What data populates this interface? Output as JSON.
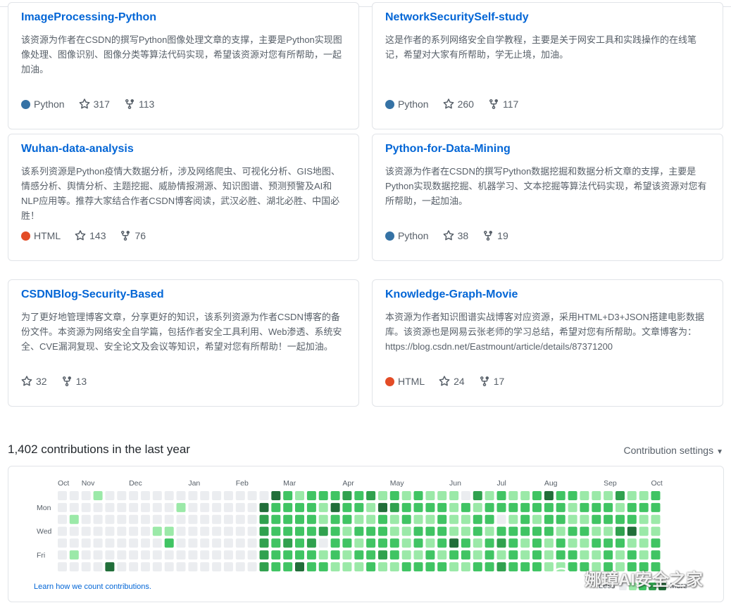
{
  "repos": [
    {
      "name": "ImageProcessing-Python",
      "description": "该资源为作者在CSDN的撰写Python图像处理文章的支撑，主要是Python实现图像处理、图像识别、图像分类等算法代码实现，希望该资源对您有所帮助，一起加油。",
      "language": "Python",
      "language_color": "#3572A5",
      "stars": "317",
      "forks": "113"
    },
    {
      "name": "NetworkSecuritySelf-study",
      "description": "这是作者的系列网络安全自学教程，主要是关于网安工具和实践操作的在线笔记，希望对大家有所帮助，学无止境，加油。",
      "language": "Python",
      "language_color": "#3572A5",
      "stars": "260",
      "forks": "117"
    },
    {
      "name": "Wuhan-data-analysis",
      "description": "该系列资源是Python疫情大数据分析，涉及网络爬虫、可视化分析、GIS地图、情感分析、舆情分析、主题挖掘、威胁情报溯源、知识图谱、预测预警及AI和NLP应用等。推荐大家结合作者CSDN博客阅读，武汉必胜、湖北必胜、中国必胜！",
      "language": "HTML",
      "language_color": "#e34c26",
      "stars": "143",
      "forks": "76"
    },
    {
      "name": "Python-for-Data-Mining",
      "description": "该资源为作者在CSDN的撰写Python数据挖掘和数据分析文章的支撑，主要是Python实现数据挖掘、机器学习、文本挖掘等算法代码实现，希望该资源对您有所帮助，一起加油。",
      "language": "Python",
      "language_color": "#3572A5",
      "stars": "38",
      "forks": "19"
    },
    {
      "name": "CSDNBlog-Security-Based",
      "description": "为了更好地管理博客文章，分享更好的知识，该系列资源为作者CSDN博客的备份文件。本资源为网络安全自学篇，包括作者安全工具利用、Web渗透、系统安全、CVE漏洞复现、安全论文及会议等知识，希望对您有所帮助！一起加油。",
      "language": "",
      "language_color": "",
      "stars": "32",
      "forks": "13"
    },
    {
      "name": "Knowledge-Graph-Movie",
      "description": "本资源为作者知识图谱实战博客对应资源，采用HTML+D3+JSON搭建电影数据库。该资源也是网易云张老师的学习总结，希望对您有所帮助。文章博客为：https://blog.csdn.net/Eastmount/article/details/87371200",
      "language": "HTML",
      "language_color": "#e34c26",
      "stars": "24",
      "forks": "17"
    }
  ],
  "contributions": {
    "title": "1,402 contributions in the last year",
    "settings_label": "Contribution settings",
    "months": [
      "Oct",
      "Nov",
      "Dec",
      "Jan",
      "Feb",
      "Mar",
      "Apr",
      "May",
      "Jun",
      "Jul",
      "Aug",
      "Sep",
      "Oct"
    ],
    "month_week_index": [
      0,
      2,
      6,
      11,
      15,
      19,
      24,
      28,
      33,
      37,
      41,
      46,
      50
    ],
    "day_labels": [
      "",
      "Mon",
      "",
      "Wed",
      "",
      "Fri",
      ""
    ],
    "learn_link": "Learn how we count contributions.",
    "legend_less": "Less",
    "legend_more": "More",
    "colors": [
      "#ebedf0",
      "#9be9a8",
      "#40c463",
      "#30a14e",
      "#216e39"
    ],
    "weeks": [
      [
        0,
        0,
        0,
        0,
        0,
        0,
        0
      ],
      [
        0,
        0,
        1,
        0,
        0,
        1,
        0
      ],
      [
        0,
        0,
        0,
        0,
        0,
        0,
        0
      ],
      [
        1,
        0,
        0,
        0,
        0,
        0,
        0
      ],
      [
        0,
        0,
        0,
        0,
        0,
        0,
        4
      ],
      [
        0,
        0,
        0,
        0,
        0,
        0,
        0
      ],
      [
        0,
        0,
        0,
        0,
        0,
        0,
        0
      ],
      [
        0,
        0,
        0,
        0,
        0,
        0,
        0
      ],
      [
        0,
        0,
        0,
        1,
        0,
        0,
        0
      ],
      [
        0,
        0,
        0,
        1,
        2,
        0,
        0
      ],
      [
        0,
        1,
        0,
        0,
        0,
        0,
        0
      ],
      [
        0,
        0,
        0,
        0,
        0,
        0,
        0
      ],
      [
        0,
        0,
        0,
        0,
        0,
        0,
        0
      ],
      [
        0,
        0,
        0,
        0,
        0,
        0,
        0
      ],
      [
        0,
        0,
        0,
        0,
        0,
        0,
        0
      ],
      [
        0,
        0,
        0,
        0,
        0,
        0,
        0
      ],
      [
        0,
        0,
        0,
        0,
        0,
        0,
        0
      ],
      [
        0,
        4,
        3,
        3,
        3,
        3,
        3
      ],
      [
        4,
        2,
        2,
        2,
        2,
        2,
        2
      ],
      [
        2,
        2,
        2,
        2,
        3,
        2,
        2
      ],
      [
        1,
        2,
        2,
        2,
        2,
        2,
        4
      ],
      [
        2,
        2,
        2,
        2,
        3,
        2,
        2
      ],
      [
        2,
        1,
        1,
        3,
        0,
        1,
        2
      ],
      [
        2,
        4,
        2,
        2,
        2,
        2,
        1
      ],
      [
        3,
        2,
        2,
        1,
        2,
        1,
        1
      ],
      [
        2,
        2,
        1,
        2,
        1,
        2,
        1
      ],
      [
        3,
        1,
        1,
        2,
        2,
        2,
        2
      ],
      [
        1,
        4,
        2,
        2,
        2,
        3,
        1
      ],
      [
        2,
        3,
        1,
        1,
        2,
        2,
        1
      ],
      [
        1,
        2,
        2,
        1,
        1,
        1,
        2
      ],
      [
        2,
        2,
        1,
        2,
        2,
        1,
        2
      ],
      [
        1,
        2,
        1,
        2,
        1,
        2,
        2
      ],
      [
        1,
        2,
        2,
        2,
        2,
        1,
        2
      ],
      [
        1,
        1,
        1,
        1,
        4,
        2,
        1
      ],
      [
        0,
        2,
        1,
        1,
        2,
        2,
        1
      ],
      [
        3,
        1,
        2,
        2,
        1,
        1,
        2
      ],
      [
        1,
        2,
        2,
        1,
        2,
        2,
        2
      ],
      [
        2,
        2,
        0,
        2,
        3,
        1,
        3
      ],
      [
        1,
        2,
        1,
        2,
        2,
        2,
        2
      ],
      [
        1,
        2,
        2,
        2,
        1,
        1,
        2
      ],
      [
        2,
        2,
        1,
        2,
        2,
        2,
        2
      ],
      [
        4,
        2,
        2,
        2,
        1,
        1,
        1
      ],
      [
        2,
        2,
        2,
        1,
        2,
        2,
        1
      ],
      [
        2,
        1,
        1,
        2,
        1,
        2,
        2
      ],
      [
        1,
        2,
        1,
        2,
        1,
        1,
        2
      ],
      [
        1,
        2,
        2,
        1,
        2,
        1,
        1
      ],
      [
        1,
        2,
        2,
        1,
        2,
        2,
        2
      ],
      [
        3,
        1,
        2,
        3,
        2,
        1,
        1
      ],
      [
        1,
        2,
        2,
        4,
        1,
        2,
        2
      ],
      [
        1,
        2,
        1,
        1,
        1,
        1,
        2
      ],
      [
        2,
        2,
        1,
        1,
        2,
        2,
        2
      ]
    ]
  },
  "watermark": "娜璋AI安全之家"
}
